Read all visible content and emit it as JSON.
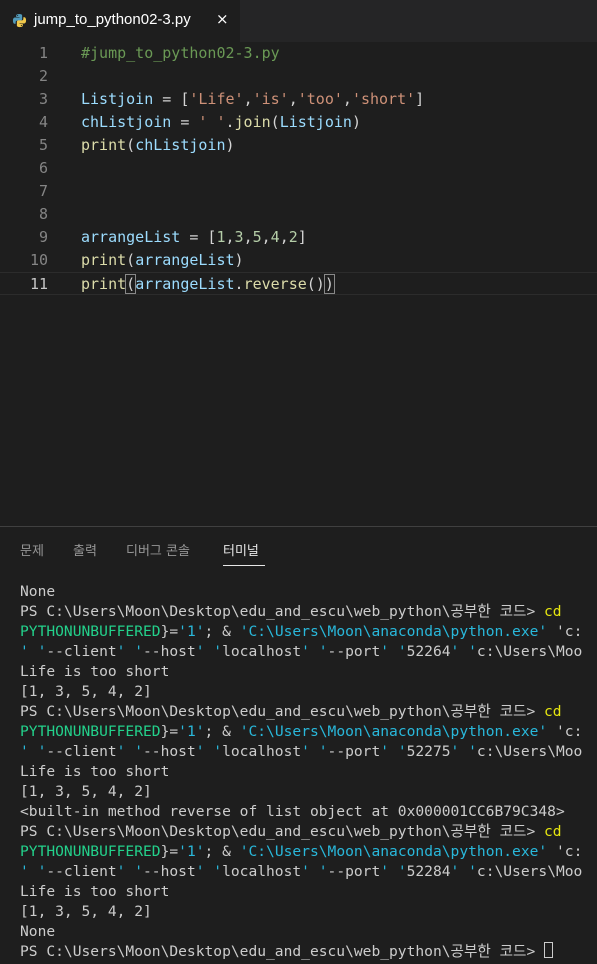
{
  "tab": {
    "filename": "jump_to_python02-3.py",
    "close_glyph": "×",
    "icon": "python-icon"
  },
  "editor": {
    "active_line": 11,
    "lines": [
      {
        "num": "1",
        "text": "#jump_to_python02-3.py"
      },
      {
        "num": "2",
        "text": ""
      },
      {
        "num": "3",
        "text": "Listjoin = ['Life','is','too','short']"
      },
      {
        "num": "4",
        "text": "chListjoin = ' '.join(Listjoin)"
      },
      {
        "num": "5",
        "text": "print(chListjoin)"
      },
      {
        "num": "6",
        "text": ""
      },
      {
        "num": "7",
        "text": ""
      },
      {
        "num": "8",
        "text": ""
      },
      {
        "num": "9",
        "text": "arrangeList = [1,3,5,4,2]"
      },
      {
        "num": "10",
        "text": "print(arrangeList)"
      },
      {
        "num": "11",
        "text": "print(arrangeList.reverse())"
      }
    ]
  },
  "panel": {
    "tabs": [
      "문제",
      "출력",
      "디버그 콘솔",
      "터미널"
    ],
    "active_tab": "터미널"
  },
  "terminal": {
    "lines": [
      "None",
      "PS C:\\Users\\Moon\\Desktop\\edu_and_escu\\web_python\\공부한 코드> cd",
      "PYTHONUNBUFFERED}='1'; & 'C:\\Users\\Moon\\anaconda\\python.exe' 'c:",
      "' '--client' '--host' 'localhost' '--port' '52264' 'c:\\Users\\Moo",
      "Life is too short",
      "[1, 3, 5, 4, 2]",
      "PS C:\\Users\\Moon\\Desktop\\edu_and_escu\\web_python\\공부한 코드> cd",
      "PYTHONUNBUFFERED}='1'; & 'C:\\Users\\Moon\\anaconda\\python.exe' 'c:",
      "' '--client' '--host' 'localhost' '--port' '52275' 'c:\\Users\\Moo",
      "Life is too short",
      "[1, 3, 5, 4, 2]",
      "<built-in method reverse of list object at 0x000001CC6B79C348>",
      "PS C:\\Users\\Moon\\Desktop\\edu_and_escu\\web_python\\공부한 코드> cd",
      "PYTHONUNBUFFERED}='1'; & 'C:\\Users\\Moon\\anaconda\\python.exe' 'c:",
      "' '--client' '--host' 'localhost' '--port' '52284' 'c:\\Users\\Moo",
      "Life is too short",
      "[1, 3, 5, 4, 2]",
      "None",
      "PS C:\\Users\\Moon\\Desktop\\edu_and_escu\\web_python\\공부한 코드> "
    ]
  },
  "colors": {
    "background": "#1e1e1e",
    "comment": "#6a9955",
    "string": "#ce9178",
    "number": "#b5cea8",
    "variable": "#9cdcfe",
    "function": "#dcdcaa",
    "terminal_green": "#23d18b",
    "terminal_cyan": "#29b8db",
    "terminal_yellow": "#e5e510"
  }
}
